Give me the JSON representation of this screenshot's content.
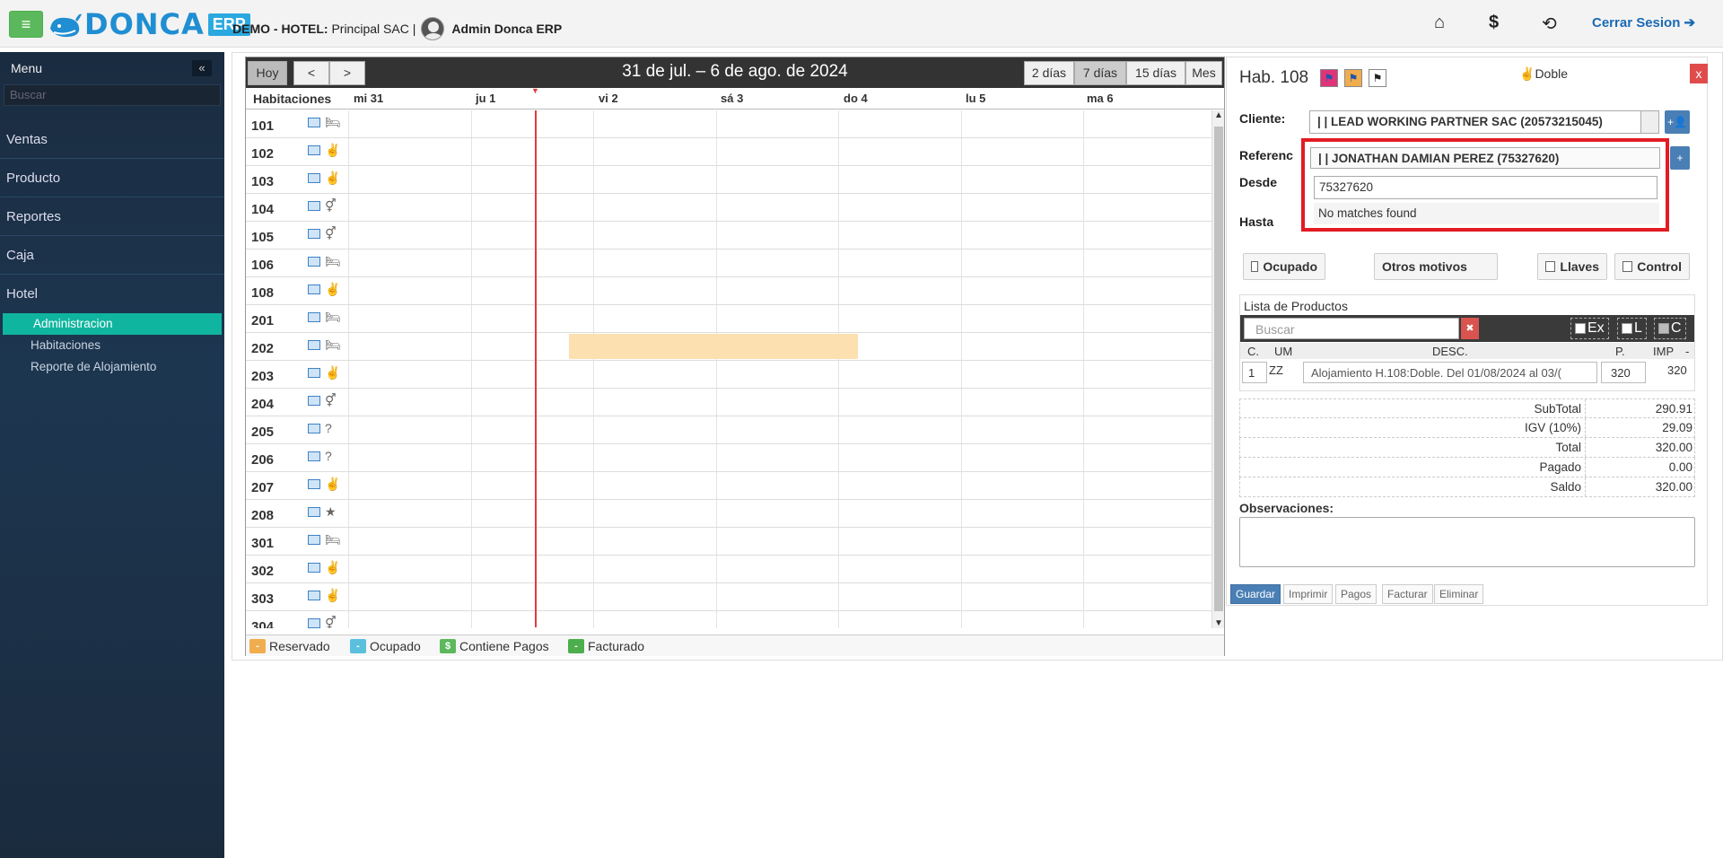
{
  "topbar": {
    "menu_icon": "hamburger-icon",
    "brand": "DONCA",
    "brand_tag": "ERP",
    "hotel_prefix": "DEMO - HOTEL:",
    "hotel_name": "Principal SAC |",
    "user": "Admin Donca ERP",
    "logout": "Cerrar Sesion"
  },
  "sidebar": {
    "title": "Menu",
    "collapse_icon": "«",
    "search_placeholder": "Buscar",
    "items": [
      {
        "label": "Ventas"
      },
      {
        "label": "Producto"
      },
      {
        "label": "Reportes"
      },
      {
        "label": "Caja"
      },
      {
        "label": "Hotel"
      }
    ],
    "subitems": [
      {
        "label": "Administracion",
        "active": true
      },
      {
        "label": "Habitaciones",
        "active": false
      },
      {
        "label": "Reporte de Alojamiento",
        "active": false
      }
    ]
  },
  "calendar": {
    "today_btn": "Hoy",
    "prev": "<",
    "next": ">",
    "title": "31 de jul. – 6 de ago. de 2024",
    "views": [
      "2 días",
      "7 días",
      "15 días",
      "Mes"
    ],
    "active_view": "7 días",
    "rooms_header": "Habitaciones",
    "days": [
      "mi 31",
      "ju 1",
      "vi 2",
      "sá 3",
      "do 4",
      "lu 5",
      "ma 6"
    ],
    "rooms": [
      {
        "num": "101",
        "icon": "bed-icon"
      },
      {
        "num": "102",
        "icon": "peace-hand-icon"
      },
      {
        "num": "103",
        "icon": "peace-hand-icon"
      },
      {
        "num": "104",
        "icon": "gender-icon"
      },
      {
        "num": "105",
        "icon": "gender-icon"
      },
      {
        "num": "106",
        "icon": "bed-icon"
      },
      {
        "num": "108",
        "icon": "peace-hand-icon"
      },
      {
        "num": "201",
        "icon": "bed-icon"
      },
      {
        "num": "202",
        "icon": "bed-icon"
      },
      {
        "num": "203",
        "icon": "peace-hand-icon"
      },
      {
        "num": "204",
        "icon": "gender-icon"
      },
      {
        "num": "205",
        "icon": "question-icon"
      },
      {
        "num": "206",
        "icon": "question-icon"
      },
      {
        "num": "207",
        "icon": "peace-hand-icon"
      },
      {
        "num": "208",
        "icon": "star-icon"
      },
      {
        "num": "301",
        "icon": "bed-icon"
      },
      {
        "num": "302",
        "icon": "peace-hand-icon"
      },
      {
        "num": "303",
        "icon": "peace-hand-icon"
      },
      {
        "num": "304",
        "icon": "gender-icon"
      }
    ],
    "legend": [
      {
        "symbol": "-",
        "label": "Reservado",
        "color": "#f0ad4e"
      },
      {
        "symbol": "-",
        "label": "Ocupado",
        "color": "#5bc0de"
      },
      {
        "symbol": "$",
        "label": "Contiene Pagos",
        "color": "#5cb85c"
      },
      {
        "symbol": "-",
        "label": "Facturado",
        "color": "#4cae4c"
      }
    ]
  },
  "panel": {
    "title": "Hab. 108",
    "type": "Doble",
    "close": "x",
    "cliente_label": "Cliente:",
    "cliente_value": "| | LEAD WORKING PARTNER SAC (20573215045)",
    "referencia_label": "Referenc",
    "desde_label": "Desde",
    "hasta_label": "Hasta",
    "dropdown": {
      "selected": "| | JONATHAN DAMIAN PEREZ (75327620)",
      "search_value": "75327620",
      "no_matches": "No matches found"
    },
    "ocupado": "Ocupado",
    "otros_motivos": "Otros motivos",
    "llaves": "Llaves",
    "control": "Control",
    "productos_label": "Lista de Productos",
    "productos_search": "Buscar",
    "prod_checks": [
      "Ex",
      "L",
      "C"
    ],
    "table_headers": {
      "c": "C.",
      "um": "UM",
      "desc": "DESC.",
      "p": "P.",
      "imp": "IMP",
      "minus": "-"
    },
    "row": {
      "c": "1",
      "um": "ZZ",
      "desc": "Alojamiento H.108:Doble. Del 01/08/2024 al 03/(",
      "p": "320",
      "imp": "320"
    },
    "totals": [
      {
        "label": "SubTotal",
        "value": "290.91"
      },
      {
        "label": "IGV (10%)",
        "value": "29.09"
      },
      {
        "label": "Total",
        "value": "320.00"
      },
      {
        "label": "Pagado",
        "value": "0.00"
      },
      {
        "label": "Saldo",
        "value": "320.00"
      }
    ],
    "obs_label": "Observaciones:",
    "buttons": [
      "Guardar",
      "Imprimir",
      "Pagos",
      "Facturar",
      "Eliminar"
    ]
  }
}
